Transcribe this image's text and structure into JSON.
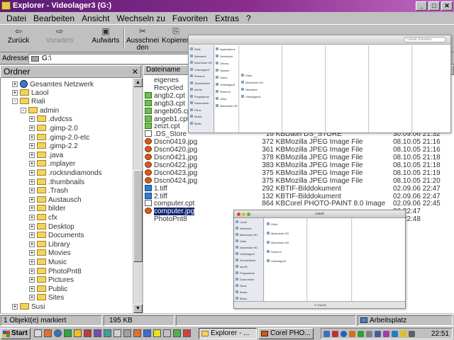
{
  "window": {
    "title": "Explorer - Videolager3 (G:)"
  },
  "menu": [
    "Datei",
    "Bearbeiten",
    "Ansicht",
    "Wechseln zu",
    "Favoriten",
    "Extras",
    "?"
  ],
  "toolbar": {
    "back": "Zurück",
    "forward": "Vorwärts",
    "up": "Aufwärts",
    "cut_1": "Ausschnei",
    "cut_2": "den",
    "copy": "Kopieren"
  },
  "address": {
    "label": "Adresse",
    "value": "G:\\"
  },
  "folders": {
    "header": "Ordner",
    "items": [
      {
        "label": "Gesamtes Netzwerk",
        "kind": "globe",
        "expander": "+"
      },
      {
        "label": "Laool",
        "kind": "folder",
        "expander": "+"
      },
      {
        "label": "Riali",
        "kind": "folder",
        "expander": "-"
      },
      {
        "label": "admin",
        "kind": "folder",
        "expander": "-"
      },
      {
        "label": ".dvdcss",
        "kind": "folder",
        "expander": "+"
      },
      {
        "label": ".gimp-2.0",
        "kind": "folder",
        "expander": "+"
      },
      {
        "label": ".gimp-2.0-etc",
        "kind": "folder",
        "expander": "+"
      },
      {
        "label": ".gimp-2.2",
        "kind": "folder",
        "expander": "+"
      },
      {
        "label": ".java",
        "kind": "folder",
        "expander": "+"
      },
      {
        "label": ".mplayer",
        "kind": "folder",
        "expander": "+"
      },
      {
        "label": ".rocksndiamonds",
        "kind": "folder",
        "expander": "+"
      },
      {
        "label": ".thumbnails",
        "kind": "folder",
        "expander": "+"
      },
      {
        "label": ".Trash",
        "kind": "folder",
        "expander": "+"
      },
      {
        "label": "Austausch",
        "kind": "folder",
        "expander": "+"
      },
      {
        "label": "bilder",
        "kind": "folder",
        "expander": "+"
      },
      {
        "label": "cfx",
        "kind": "folder",
        "expander": "+"
      },
      {
        "label": "Desktop",
        "kind": "folder",
        "expander": "+"
      },
      {
        "label": "Documents",
        "kind": "folder",
        "expander": "+"
      },
      {
        "label": "Library",
        "kind": "folder",
        "expander": "+"
      },
      {
        "label": "Movies",
        "kind": "folder",
        "expander": "+"
      },
      {
        "label": "Music",
        "kind": "folder",
        "expander": "+"
      },
      {
        "label": "PhotoPnt8",
        "kind": "folder",
        "expander": "+"
      },
      {
        "label": "Pictures",
        "kind": "folder",
        "expander": "+"
      },
      {
        "label": "Public",
        "kind": "folder",
        "expander": "+"
      },
      {
        "label": "Sites",
        "kind": "folder",
        "expander": "+"
      },
      {
        "label": "Susi",
        "kind": "folder",
        "expander": "+"
      }
    ]
  },
  "filelist": {
    "columns": {
      "name": "Dateiname"
    },
    "files": [
      {
        "name": "eigenes",
        "icon": "folder",
        "size": "",
        "type": "",
        "date": ""
      },
      {
        "name": "Recycled",
        "icon": "folder",
        "size": "",
        "type": "",
        "date": ""
      },
      {
        "name": "angb2.cpt",
        "icon": "cpt",
        "size": "",
        "type": "",
        "date": ""
      },
      {
        "name": "angb3.cpt",
        "icon": "cpt",
        "size": "",
        "type": "",
        "date": ""
      },
      {
        "name": "angeb05.cpt",
        "icon": "cpt",
        "size": "",
        "type": "",
        "date": ""
      },
      {
        "name": "angeb1.cpt",
        "icon": "cpt",
        "size": "",
        "type": "",
        "date": ""
      },
      {
        "name": "zeizt.cpt",
        "icon": "cpt",
        "size": "",
        "type": "",
        "date": ""
      },
      {
        "name": ".DS_Store",
        "icon": "doc",
        "size": "16 KB",
        "type": "Datei DS_STORE",
        "date": "30.09.06 21:32"
      },
      {
        "name": "Dscn0419.jpg",
        "icon": "jpg",
        "size": "372 KB",
        "type": "Mozilla JPEG Image File",
        "date": "08.10.05 21:16"
      },
      {
        "name": "Dscn0420.jpg",
        "icon": "jpg",
        "size": "361 KB",
        "type": "Mozilla JPEG Image File",
        "date": "08.10.05 21:16"
      },
      {
        "name": "Dscn0421.jpg",
        "icon": "jpg",
        "size": "378 KB",
        "type": "Mozilla JPEG Image File",
        "date": "08.10.05 21:18"
      },
      {
        "name": "Dscn0422.jpg",
        "icon": "jpg",
        "size": "383 KB",
        "type": "Mozilla JPEG Image File",
        "date": "08.10.05 21:18"
      },
      {
        "name": "Dscn0423.jpg",
        "icon": "jpg",
        "size": "375 KB",
        "type": "Mozilla JPEG Image File",
        "date": "08.10.05 21:19"
      },
      {
        "name": "Dscn0424.jpg",
        "icon": "jpg",
        "size": "375 KB",
        "type": "Mozilla JPEG Image File",
        "date": "08.10.05 21:20"
      },
      {
        "name": "1.tiff",
        "icon": "tif",
        "size": "292 KB",
        "type": "TIF-Bilddokument",
        "date": "02.09.06 22:47"
      },
      {
        "name": "2.tiff",
        "icon": "tif",
        "size": "132 KB",
        "type": "TIF-Bilddokument",
        "date": "02.09.06 22:47"
      },
      {
        "name": "computer.cpt",
        "icon": "doc",
        "size": "864 KB",
        "type": "Corel PHOTO-PAINT 8.0 Image",
        "date": "02.09.06 22:45"
      },
      {
        "name": "computer.jpg",
        "icon": "jpg",
        "size": "",
        "type": "",
        "date": "06 22:47",
        "selected": true
      },
      {
        "name": "PhotoPnt8",
        "icon": "folder",
        "size": "",
        "type": "",
        "date": "06 22:48"
      }
    ]
  },
  "overlay_finder": {
    "search": "Lokale Volumes",
    "sidebar": [
      "iDisk",
      "Netzwerk",
      "Macintosh HD",
      "Videolager3",
      "Reserve",
      "Schreibtisch",
      "admin",
      "Programme",
      "Dokumente",
      "Filme",
      "Musik",
      "Bilder"
    ],
    "col1": [
      "Applications",
      "Developer",
      "Library",
      "System",
      "Users",
      "Videolager3",
      "Reserve",
      "Vista",
      "Macintosh HD"
    ],
    "col2": [
      "Vista",
      "Macintosh HD",
      "Netzwerk",
      "Videolager3"
    ]
  },
  "overlay_finder2": {
    "title": "Laool",
    "sidebar": [
      "Laool",
      "Netzwerk",
      "Macintosh HD",
      "Vista",
      "Macintosh HD",
      "Videolager3",
      "Schreibtisch",
      "laoolfi",
      "Programme",
      "Dokumente",
      "Filme",
      "Musik",
      "Bilder"
    ],
    "col1": [
      "Vista",
      "Macintosh HD",
      "Macintosh HD",
      "Reserve",
      "Videolager3"
    ],
    "status": "5 Objekte"
  },
  "status": {
    "left": "1 Objekt(e) markiert",
    "size": "195 KB",
    "location": "Arbeitsplatz"
  },
  "taskbar": {
    "start": "Start",
    "buttons": [
      "Explorer - ...",
      "Corel PHO..."
    ],
    "clock": "22:51"
  }
}
